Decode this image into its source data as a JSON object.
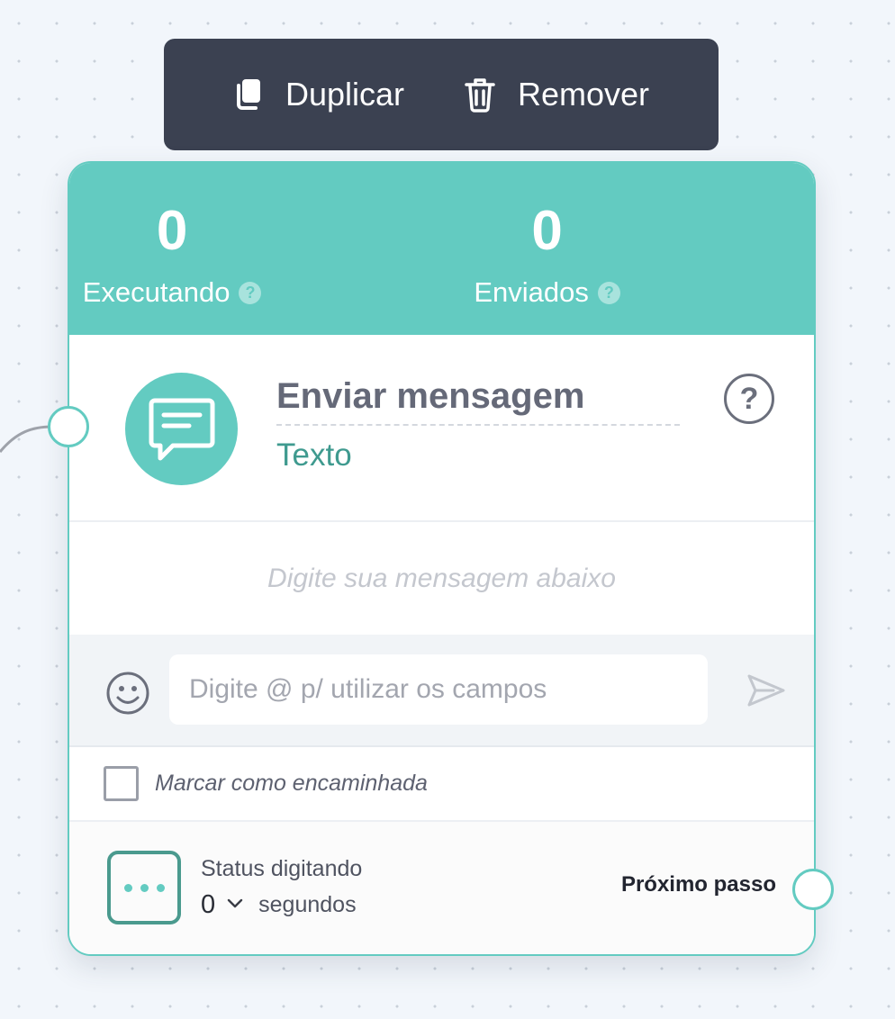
{
  "toolbar": {
    "duplicate_label": "Duplicar",
    "remove_label": "Remover"
  },
  "stats": {
    "running": {
      "value": "0",
      "label": "Executando"
    },
    "sent": {
      "value": "0",
      "label": "Enviados"
    }
  },
  "node": {
    "title": "Enviar mensagem",
    "subtitle": "Texto",
    "help_symbol": "?"
  },
  "message": {
    "empty_hint": "Digite sua mensagem abaixo",
    "input_placeholder": "Digite @ p/ utilizar os campos",
    "input_value": ""
  },
  "forward": {
    "label": "Marcar como encaminhada",
    "checked": false
  },
  "typing": {
    "title": "Status digitando",
    "value": "0",
    "unit": "segundos"
  },
  "next_step_label": "Próximo passo",
  "icons": {
    "duplicate": "copy-icon",
    "remove": "trash-icon",
    "message": "chat-bubble-icon",
    "emoji": "smiley-icon",
    "send": "send-icon",
    "typing": "typing-dots-icon"
  },
  "colors": {
    "accent": "#63cbc1",
    "accent_dark": "#3f9a8f",
    "toolbar_bg": "#3b4151",
    "canvas_bg": "#f2f6fb"
  }
}
